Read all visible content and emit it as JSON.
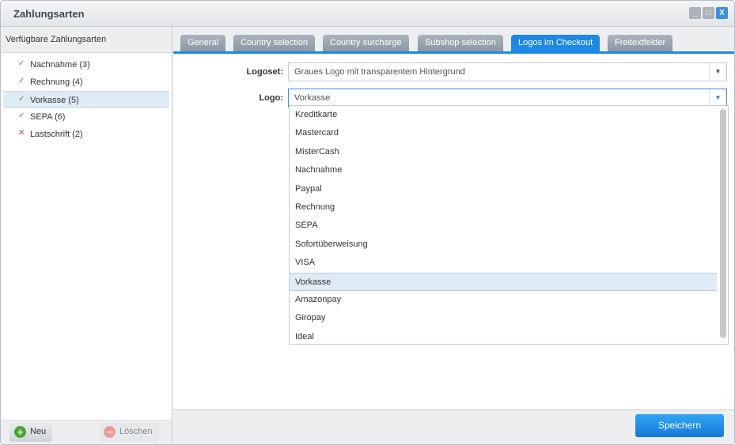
{
  "window": {
    "title": "Zahlungsarten"
  },
  "sidebar": {
    "header": "Verfügbare Zahlungsarten",
    "items": [
      {
        "label": "Nachnahme (3)",
        "status": "active"
      },
      {
        "label": "Rechnung (4)",
        "status": "active"
      },
      {
        "label": "Vorkasse (5)",
        "status": "active",
        "selected": true
      },
      {
        "label": "SEPA (6)",
        "status": "active"
      },
      {
        "label": "Lastschrift (2)",
        "status": "inactive"
      }
    ],
    "new_label": "Neu",
    "delete_label": "Löschen"
  },
  "tabs": [
    "General",
    "Country selection",
    "Country surcharge",
    "Subshop selection",
    "Logos im Checkout",
    "Freitextfelder"
  ],
  "active_tab": "Logos im Checkout",
  "form": {
    "logoset_label": "Logoset:",
    "logoset_value": "Graues Logo mit transparentem Hintergrund",
    "logo_label": "Logo:",
    "logo_value": "Vorkasse"
  },
  "dropdown": [
    "Kreditkarte",
    "Mastercard",
    "MisterCash",
    "Nachnahme",
    "Paypal",
    "Rechnung",
    "SEPA",
    "Sofortüberweisung",
    "VISA",
    "Vorkasse",
    "Amazonpay",
    "Giropay",
    "Ideal"
  ],
  "save_label": "Speichern",
  "colors": {
    "accent": "#1e88e5"
  }
}
